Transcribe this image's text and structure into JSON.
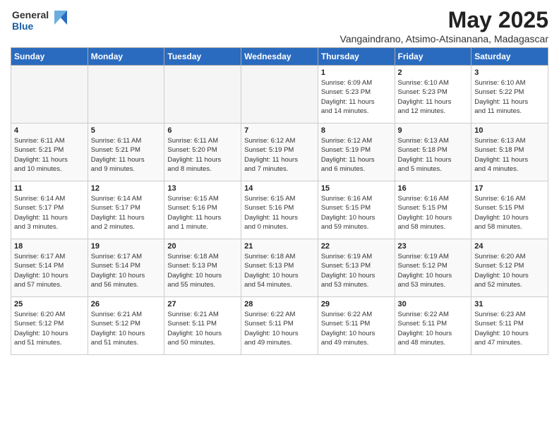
{
  "logo": {
    "general": "General",
    "blue": "Blue"
  },
  "title": "May 2025",
  "subtitle": "Vangaindrano, Atsimo-Atsinanana, Madagascar",
  "weekdays": [
    "Sunday",
    "Monday",
    "Tuesday",
    "Wednesday",
    "Thursday",
    "Friday",
    "Saturday"
  ],
  "weeks": [
    [
      {
        "day": "",
        "info": ""
      },
      {
        "day": "",
        "info": ""
      },
      {
        "day": "",
        "info": ""
      },
      {
        "day": "",
        "info": ""
      },
      {
        "day": "1",
        "info": "Sunrise: 6:09 AM\nSunset: 5:23 PM\nDaylight: 11 hours\nand 14 minutes."
      },
      {
        "day": "2",
        "info": "Sunrise: 6:10 AM\nSunset: 5:23 PM\nDaylight: 11 hours\nand 12 minutes."
      },
      {
        "day": "3",
        "info": "Sunrise: 6:10 AM\nSunset: 5:22 PM\nDaylight: 11 hours\nand 11 minutes."
      }
    ],
    [
      {
        "day": "4",
        "info": "Sunrise: 6:11 AM\nSunset: 5:21 PM\nDaylight: 11 hours\nand 10 minutes."
      },
      {
        "day": "5",
        "info": "Sunrise: 6:11 AM\nSunset: 5:21 PM\nDaylight: 11 hours\nand 9 minutes."
      },
      {
        "day": "6",
        "info": "Sunrise: 6:11 AM\nSunset: 5:20 PM\nDaylight: 11 hours\nand 8 minutes."
      },
      {
        "day": "7",
        "info": "Sunrise: 6:12 AM\nSunset: 5:19 PM\nDaylight: 11 hours\nand 7 minutes."
      },
      {
        "day": "8",
        "info": "Sunrise: 6:12 AM\nSunset: 5:19 PM\nDaylight: 11 hours\nand 6 minutes."
      },
      {
        "day": "9",
        "info": "Sunrise: 6:13 AM\nSunset: 5:18 PM\nDaylight: 11 hours\nand 5 minutes."
      },
      {
        "day": "10",
        "info": "Sunrise: 6:13 AM\nSunset: 5:18 PM\nDaylight: 11 hours\nand 4 minutes."
      }
    ],
    [
      {
        "day": "11",
        "info": "Sunrise: 6:14 AM\nSunset: 5:17 PM\nDaylight: 11 hours\nand 3 minutes."
      },
      {
        "day": "12",
        "info": "Sunrise: 6:14 AM\nSunset: 5:17 PM\nDaylight: 11 hours\nand 2 minutes."
      },
      {
        "day": "13",
        "info": "Sunrise: 6:15 AM\nSunset: 5:16 PM\nDaylight: 11 hours\nand 1 minute."
      },
      {
        "day": "14",
        "info": "Sunrise: 6:15 AM\nSunset: 5:16 PM\nDaylight: 11 hours\nand 0 minutes."
      },
      {
        "day": "15",
        "info": "Sunrise: 6:16 AM\nSunset: 5:15 PM\nDaylight: 10 hours\nand 59 minutes."
      },
      {
        "day": "16",
        "info": "Sunrise: 6:16 AM\nSunset: 5:15 PM\nDaylight: 10 hours\nand 58 minutes."
      },
      {
        "day": "17",
        "info": "Sunrise: 6:16 AM\nSunset: 5:15 PM\nDaylight: 10 hours\nand 58 minutes."
      }
    ],
    [
      {
        "day": "18",
        "info": "Sunrise: 6:17 AM\nSunset: 5:14 PM\nDaylight: 10 hours\nand 57 minutes."
      },
      {
        "day": "19",
        "info": "Sunrise: 6:17 AM\nSunset: 5:14 PM\nDaylight: 10 hours\nand 56 minutes."
      },
      {
        "day": "20",
        "info": "Sunrise: 6:18 AM\nSunset: 5:13 PM\nDaylight: 10 hours\nand 55 minutes."
      },
      {
        "day": "21",
        "info": "Sunrise: 6:18 AM\nSunset: 5:13 PM\nDaylight: 10 hours\nand 54 minutes."
      },
      {
        "day": "22",
        "info": "Sunrise: 6:19 AM\nSunset: 5:13 PM\nDaylight: 10 hours\nand 53 minutes."
      },
      {
        "day": "23",
        "info": "Sunrise: 6:19 AM\nSunset: 5:12 PM\nDaylight: 10 hours\nand 53 minutes."
      },
      {
        "day": "24",
        "info": "Sunrise: 6:20 AM\nSunset: 5:12 PM\nDaylight: 10 hours\nand 52 minutes."
      }
    ],
    [
      {
        "day": "25",
        "info": "Sunrise: 6:20 AM\nSunset: 5:12 PM\nDaylight: 10 hours\nand 51 minutes."
      },
      {
        "day": "26",
        "info": "Sunrise: 6:21 AM\nSunset: 5:12 PM\nDaylight: 10 hours\nand 51 minutes."
      },
      {
        "day": "27",
        "info": "Sunrise: 6:21 AM\nSunset: 5:11 PM\nDaylight: 10 hours\nand 50 minutes."
      },
      {
        "day": "28",
        "info": "Sunrise: 6:22 AM\nSunset: 5:11 PM\nDaylight: 10 hours\nand 49 minutes."
      },
      {
        "day": "29",
        "info": "Sunrise: 6:22 AM\nSunset: 5:11 PM\nDaylight: 10 hours\nand 49 minutes."
      },
      {
        "day": "30",
        "info": "Sunrise: 6:22 AM\nSunset: 5:11 PM\nDaylight: 10 hours\nand 48 minutes."
      },
      {
        "day": "31",
        "info": "Sunrise: 6:23 AM\nSunset: 5:11 PM\nDaylight: 10 hours\nand 47 minutes."
      }
    ]
  ]
}
